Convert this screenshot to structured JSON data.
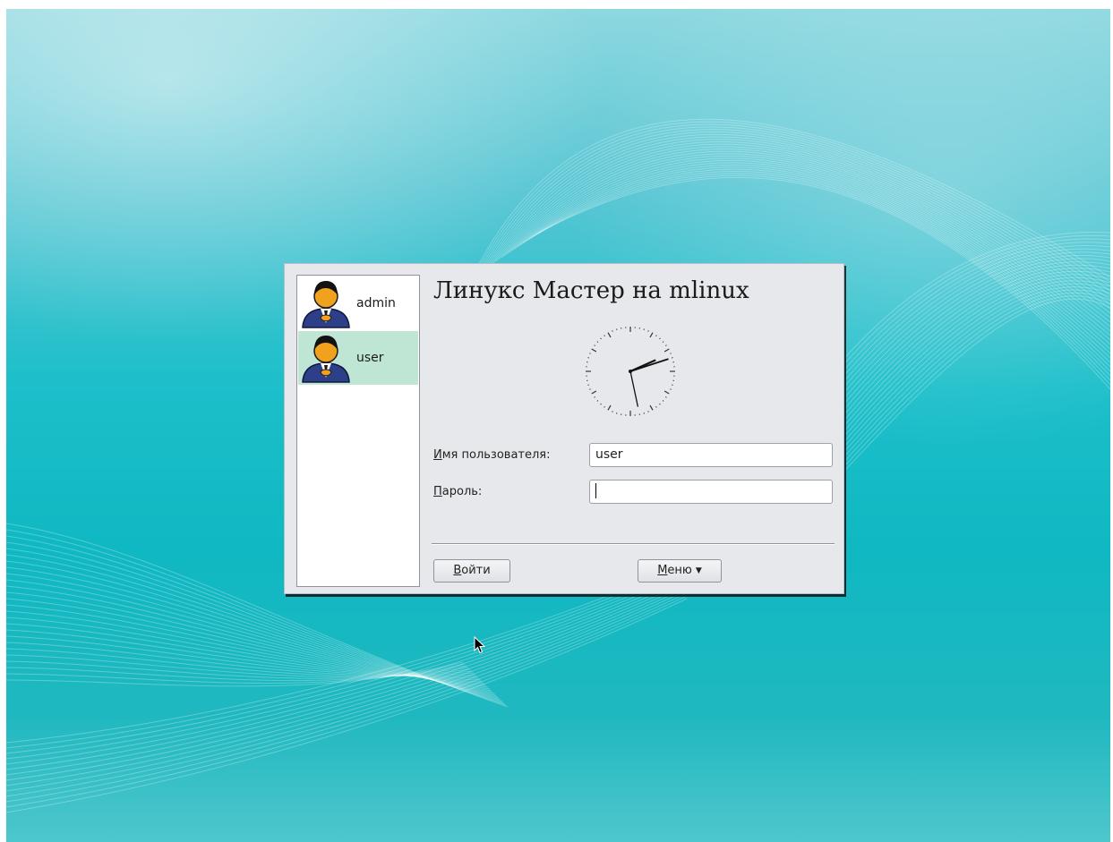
{
  "greeting": "Линукс Мастер на mlinux",
  "users": [
    {
      "name": "admin",
      "selected": false
    },
    {
      "name": "user",
      "selected": true
    }
  ],
  "form": {
    "username_label_mnemonic": "И",
    "username_label_rest": "мя пользователя:",
    "username_value": "user",
    "password_label_mnemonic": "П",
    "password_label_rest": "ароль:",
    "password_value": ""
  },
  "buttons": {
    "login_mnemonic": "В",
    "login_rest": "ойти",
    "menu_mnemonic": "М",
    "menu_rest": "еню",
    "menu_arrow": "▼"
  },
  "clock": {
    "hour": 2,
    "minute": 12,
    "second": 28
  },
  "icons": {
    "avatar": "user-avatar-icon",
    "cursor": "mouse-pointer-icon"
  },
  "colors": {
    "selected_row": "#bfe6d4",
    "dialog_bg": "#e6e8eb",
    "background": "#1cbfca"
  }
}
